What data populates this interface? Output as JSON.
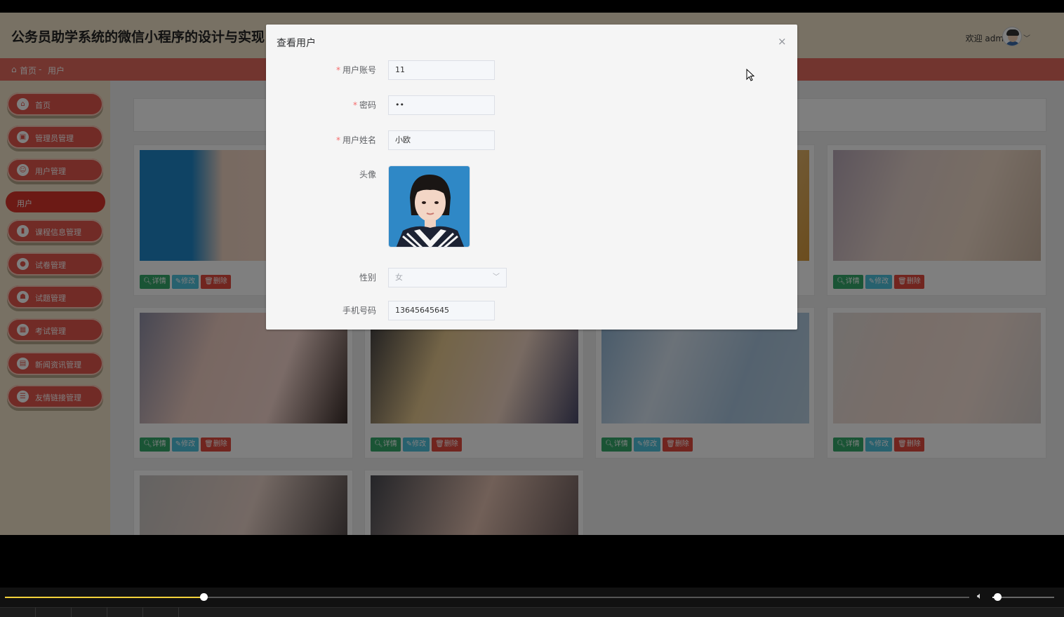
{
  "header": {
    "title": "公务员助学系统的微信小程序的设计与实现",
    "welcome": "欢迎 admin"
  },
  "breadcrumb": {
    "home": "首页",
    "separator": "-",
    "current": "用户"
  },
  "sidebar": {
    "items": [
      {
        "label": "首页",
        "icon": "home-icon"
      },
      {
        "label": "管理员管理",
        "icon": "admin-icon"
      },
      {
        "label": "用户管理",
        "icon": "user-icon"
      },
      {
        "label": "用户",
        "icon": ""
      },
      {
        "label": "课程信息管理",
        "icon": "course-icon"
      },
      {
        "label": "试卷管理",
        "icon": "paper-icon"
      },
      {
        "label": "试题管理",
        "icon": "question-icon"
      },
      {
        "label": "考试管理",
        "icon": "exam-icon"
      },
      {
        "label": "新闻资讯管理",
        "icon": "news-icon"
      },
      {
        "label": "友情链接管理",
        "icon": "link-icon"
      }
    ]
  },
  "card_actions": {
    "detail": "详情",
    "edit": "修改",
    "delete": "删除"
  },
  "dialog": {
    "title": "查看用户",
    "close": "×",
    "fields": {
      "account_label": "用户账号",
      "account_value": "11",
      "password_label": "密码",
      "password_value": "••",
      "name_label": "用户姓名",
      "name_value": "小欧",
      "avatar_label": "头像",
      "gender_label": "性别",
      "gender_value": "女",
      "phone_label": "手机号码",
      "phone_value": "13645645645"
    },
    "required_mark": "*"
  },
  "player": {
    "progress": 0.206,
    "volume": 0.05
  },
  "colors": {
    "accent": "#e2564c",
    "header_bg": "#f1e3c9",
    "breadcrumb_bg": "#e56a5e",
    "detail": "#35a86b",
    "edit": "#4fc2dd",
    "delete": "#e24b3f"
  }
}
